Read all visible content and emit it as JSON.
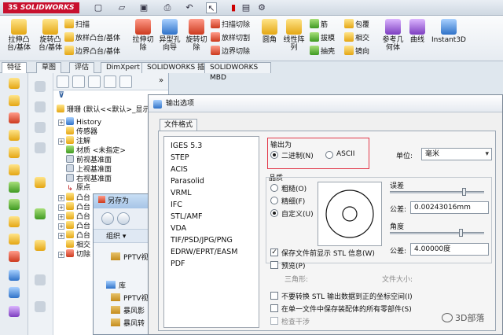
{
  "app": {
    "brand_prefix": "3S",
    "brand": "SOLIDWORKS"
  },
  "ribbon": {
    "extrude_boss": "拉伸凸\n台/基体",
    "revolve_boss": "旋转凸\n台/基体",
    "sweep": "扫描",
    "loft": "放样凸台/基体",
    "boundary_boss": "边界凸台/基体",
    "extrude_cut": "拉伸切\n除",
    "hole_wizard": "异型孔\n向导",
    "revolve_cut": "旋转切\n除",
    "swept_cut": "扫描切除",
    "lofted_cut": "放样切割",
    "boundary_cut": "边界切除",
    "fillet": "圆角",
    "linear_pattern": "线性阵\n列",
    "rib": "筋",
    "draft": "拔模",
    "shell": "抽壳",
    "wrap": "包覆",
    "intersect": "相交",
    "mirror": "镜向",
    "ref_geometry": "参考几\n何体",
    "curves": "曲线",
    "instant3d": "Instant3D"
  },
  "tabs": [
    "特征",
    "草图",
    "评估",
    "DimXpert",
    "SOLIDWORKS 插件",
    "SOLIDWORKS MBD"
  ],
  "feature_tree": {
    "filter_icon": "filter-icon",
    "root": "珊珊 (默认<<默认>_显示",
    "items": [
      "History",
      "传感器",
      "注解",
      "材质 <未指定>",
      "前视基准面",
      "上视基准面",
      "右视基准面",
      "原点",
      "凸台",
      "凸台",
      "凸台",
      "凸台",
      "凸台",
      "相交",
      "切除"
    ]
  },
  "saveas": {
    "title": "另存为",
    "organize": "组织 ▾",
    "items": [
      "PPTV视",
      "库",
      "PPTV视",
      "暴风影",
      "暴风转"
    ]
  },
  "dialog": {
    "title": "输出选项",
    "tab": "文件格式",
    "formats": [
      "IGES 5.3",
      "STEP",
      "ACIS",
      "Parasolid",
      "VRML",
      "IFC",
      "STL/AMF",
      "VDA",
      "TIF/PSD/JPG/PNG",
      "EDRW/EPRT/EASM",
      "PDF"
    ],
    "output_as_label": "输出为",
    "binary": "二进制(N)",
    "ascii": "ASCII",
    "unit_label": "单位:",
    "unit_value": "毫米",
    "quality_label": "品质",
    "coarse": "粗糙(O)",
    "fine": "精细(F)",
    "custom": "自定义(U)",
    "deviation_label": "误差",
    "tolerance_label": "公差:",
    "tolerance_value": "0.00243016mm",
    "angle_label": "角度",
    "angle_tolerance_label": "公差:",
    "angle_value": "4.00000度",
    "show_info": "保存文件前显示 STL 信息(W)",
    "preview": "预览(P)",
    "triangles": "三角形:",
    "file_size": "文件大小:",
    "no_transform": "不要转换 STL 输出数据到正的坐标空间(I)",
    "single_file": "在单一文件中保存装配体的所有零部件(S)",
    "check_interference": "检查干涉"
  },
  "watermark": {
    "text": "3D部落"
  }
}
